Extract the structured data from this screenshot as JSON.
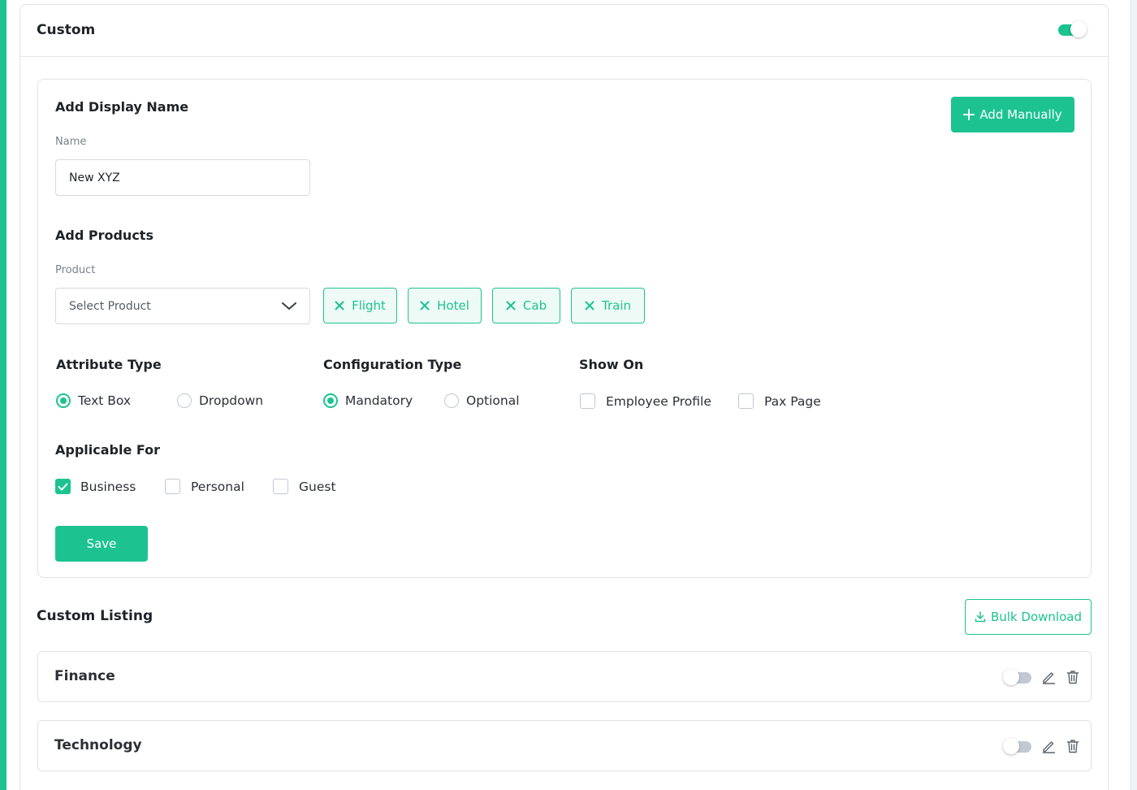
{
  "header": {
    "title": "Custom",
    "toggle_on": true
  },
  "display_name": {
    "title": "Add Display Name",
    "name_label": "Name",
    "name_value": "New XYZ",
    "add_manually_label": "Add Manually"
  },
  "products": {
    "title": "Add Products",
    "product_label": "Product",
    "select_placeholder": "Select Product",
    "chips": [
      "Flight",
      "Hotel",
      "Cab",
      "Train"
    ]
  },
  "attribute_type": {
    "title": "Attribute Type",
    "options": [
      {
        "label": "Text Box",
        "checked": true
      },
      {
        "label": "Dropdown",
        "checked": false
      }
    ]
  },
  "configuration_type": {
    "title": "Configuration Type",
    "options": [
      {
        "label": "Mandatory",
        "checked": true
      },
      {
        "label": "Optional",
        "checked": false
      }
    ]
  },
  "show_on": {
    "title": "Show On",
    "options": [
      {
        "label": "Employee Profile",
        "checked": false
      },
      {
        "label": "Pax Page",
        "checked": false
      }
    ]
  },
  "applicable_for": {
    "title": "Applicable For",
    "options": [
      {
        "label": "Business",
        "checked": true
      },
      {
        "label": "Personal",
        "checked": false
      },
      {
        "label": "Guest",
        "checked": false
      }
    ]
  },
  "save_label": "Save",
  "listing": {
    "title": "Custom Listing",
    "bulk_download_label": "Bulk Download",
    "rows": [
      {
        "name": "Finance",
        "toggle_on": false
      },
      {
        "name": "Technology",
        "toggle_on": false
      }
    ]
  },
  "colors": {
    "accent": "#1cc391",
    "border": "#dfe2e6",
    "text": "#1f2328"
  }
}
